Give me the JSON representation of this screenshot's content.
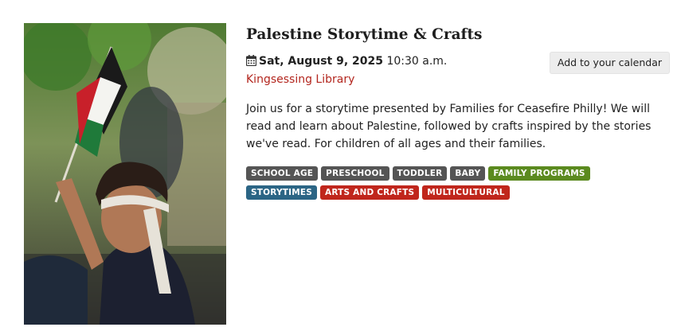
{
  "event": {
    "title": "Palestine Storytime & Crafts",
    "date": "Sat, August 9, 2025",
    "time": " 10:30 a.m.",
    "location": "Kingsessing Library",
    "description": "Join us for a storytime presented by Families for Ceasefire Philly! We will read and learn about Palestine, followed by crafts inspired by the stories we've read. For children of all ages and their families."
  },
  "actions": {
    "add_calendar_label": "Add to your calendar"
  },
  "tags": [
    {
      "label": "SCHOOL AGE",
      "color": "#555555"
    },
    {
      "label": "PRESCHOOL",
      "color": "#555555"
    },
    {
      "label": "TODDLER",
      "color": "#555555"
    },
    {
      "label": "BABY",
      "color": "#555555"
    },
    {
      "label": "FAMILY PROGRAMS",
      "color": "#5b8a1f"
    },
    {
      "label": "STORYTIMES",
      "color": "#2b6585"
    },
    {
      "label": "ARTS AND CRAFTS",
      "color": "#c0261c"
    },
    {
      "label": "MULTICULTURAL",
      "color": "#c0261c"
    }
  ],
  "colors": {
    "location_link": "#b3261e",
    "title": "#1e1e1e"
  },
  "icons": {
    "date": "calendar-icon"
  },
  "photo": {
    "subject": "child-waving-palestinian-flag"
  }
}
